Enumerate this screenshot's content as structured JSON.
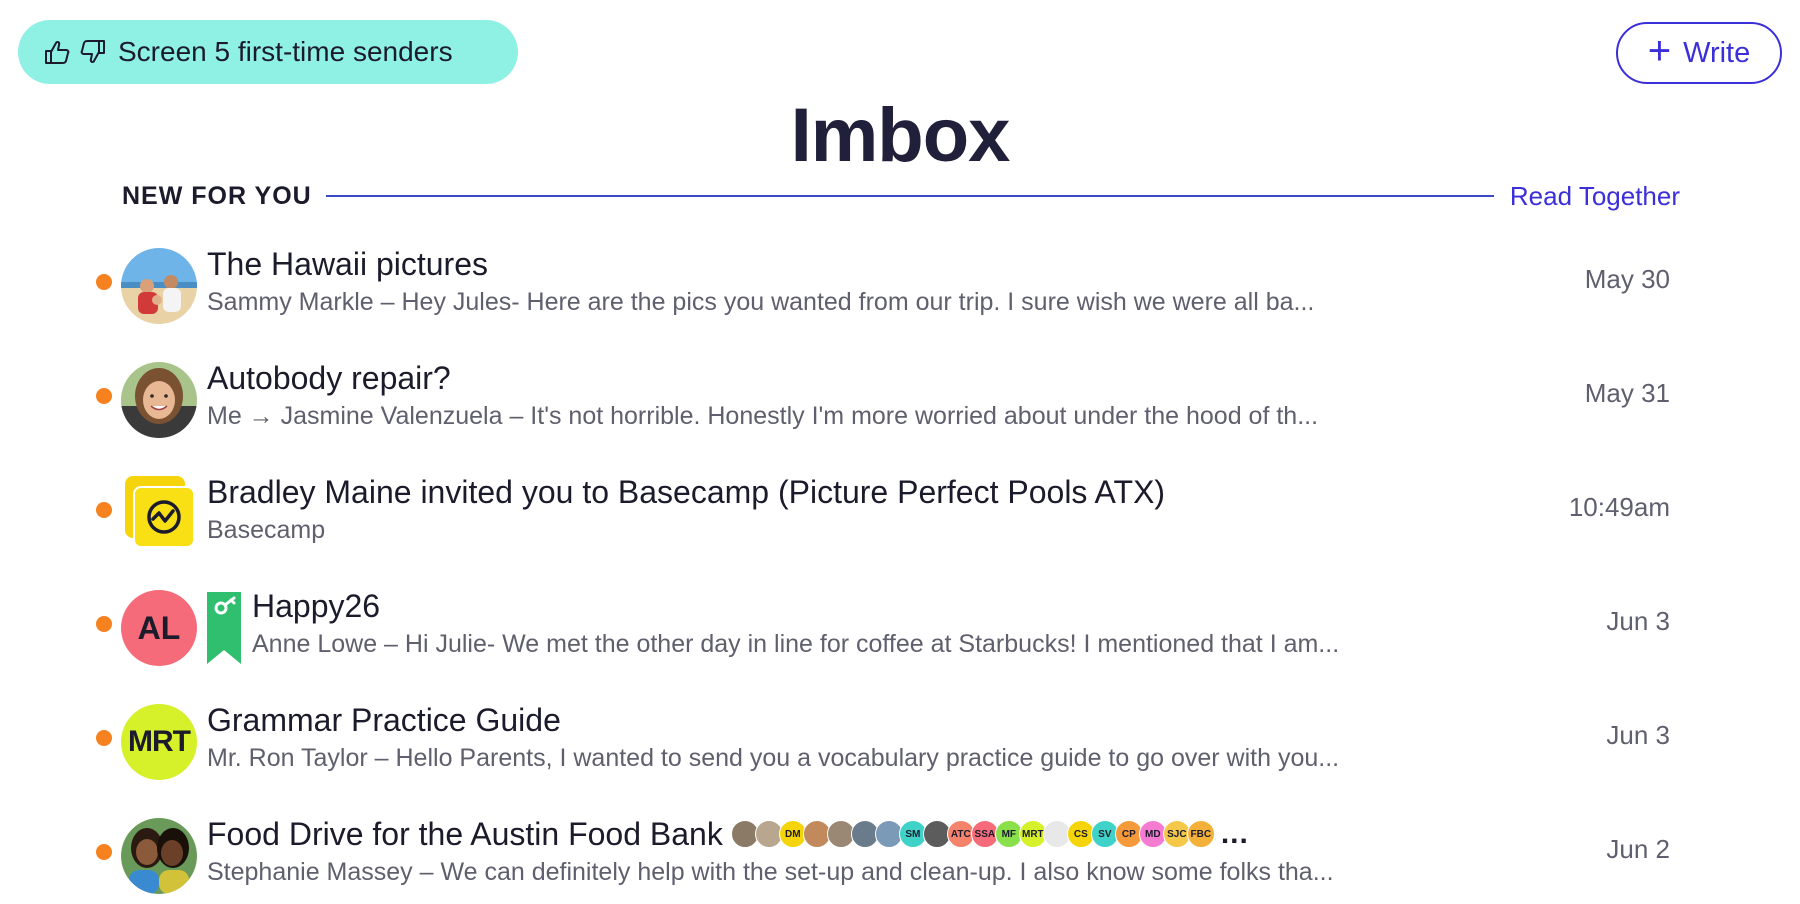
{
  "header": {
    "screen_button_label": "Screen 5 first-time senders",
    "write_button_label": "Write",
    "page_title": "Imbox"
  },
  "section": {
    "label": "NEW FOR YOU",
    "read_together_label": "Read Together"
  },
  "colors": {
    "accent": "#3b2fd9",
    "screen_button_bg": "#8ff0e4",
    "unread_dot": "#f5821f"
  },
  "threads": [
    {
      "subject": "The Hawaii pictures",
      "preview": "Sammy Markle – Hey Jules- Here are the pics you wanted from our trip. I sure wish we were all ba...",
      "date": "May 30",
      "avatar": "beach-photo-avatar"
    },
    {
      "subject": "Autobody repair?",
      "preview": "Me → Jasmine Valenzuela – It's not horrible. Honestly I'm more worried about under the hood of th...",
      "date": "May 31",
      "avatar": "portrait-avatar"
    },
    {
      "subject": "Bradley Maine invited you to Basecamp (Picture Perfect Pools ATX)",
      "preview": "Basecamp",
      "date": "10:49am",
      "avatar": "basecamp-logo"
    },
    {
      "subject": "Happy26",
      "preview": "Anne Lowe – Hi Julie- We met the other day in line for coffee at Starbucks! I mentioned that I am...",
      "date": "Jun 3",
      "avatar_initials": "AL",
      "tag_icon": "key-ribbon-icon"
    },
    {
      "subject": "Grammar Practice Guide",
      "preview": "Mr. Ron Taylor – Hello Parents, I wanted to send you a vocabulary practice guide to go over with you...",
      "date": "Jun 3",
      "avatar_initials": "MRT"
    },
    {
      "subject": "Food Drive for the Austin Food Bank",
      "preview": "Stephanie Massey – We can definitely help with the set-up and clean-up. I also know some folks tha...",
      "date": "Jun 2",
      "avatar": "two-women-photo-avatar",
      "participants": [
        {
          "label": "",
          "color": "#8a7a66"
        },
        {
          "label": "",
          "color": "#b8a68e"
        },
        {
          "label": "DM",
          "color": "#f5d50a"
        },
        {
          "label": "",
          "color": "#c28a5c"
        },
        {
          "label": "",
          "color": "#9a8874"
        },
        {
          "label": "",
          "color": "#6a7c8c"
        },
        {
          "label": "",
          "color": "#7a9ab8"
        },
        {
          "label": "SM",
          "color": "#3fd2c8"
        },
        {
          "label": "",
          "color": "#5c5c5c"
        },
        {
          "label": "ATC",
          "color": "#f5826b"
        },
        {
          "label": "SSA",
          "color": "#f56b7a"
        },
        {
          "label": "MF",
          "color": "#8ae04a"
        },
        {
          "label": "MRT",
          "color": "#d6f02a"
        },
        {
          "label": "",
          "color": "#e8e8e8"
        },
        {
          "label": "CS",
          "color": "#f5d50a"
        },
        {
          "label": "SV",
          "color": "#3fd2c8"
        },
        {
          "label": "CP",
          "color": "#f59a3a"
        },
        {
          "label": "MD",
          "color": "#f57ad2"
        },
        {
          "label": "SJC",
          "color": "#f5c84a"
        },
        {
          "label": "FBC",
          "color": "#f5b03a"
        }
      ],
      "more_label": "..."
    }
  ]
}
